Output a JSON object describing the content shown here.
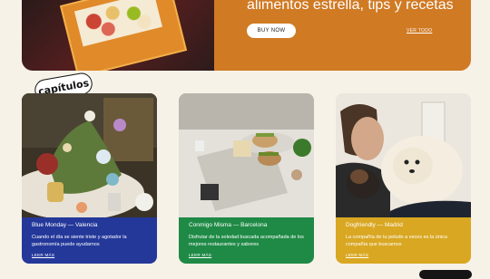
{
  "hero": {
    "title": "alimentos estrella, tips y recetas",
    "buy_label": "BUY NOW",
    "see_all_label": "VER TODO"
  },
  "section_badge": "capítulos",
  "cards": [
    {
      "title": "Blue Monday — Valencia",
      "description": "Cuando el día se siente triste y agotador la gastronomía puede ayudarnos",
      "more": "LEER MÁS",
      "accent": "#24389a"
    },
    {
      "title": "Conmigo Misma — Barcelona",
      "description": "Disfrutar de la soledad buscada acompañada de los mejores restaurantes y sabores",
      "more": "LEER MÁS",
      "accent": "#1f8a46"
    },
    {
      "title": "Dogfriendly — Madrid",
      "description": "La compañía de tu peludo a veces es la única compañía que buscamos",
      "more": "LEER MÁS",
      "accent": "#d9a722"
    }
  ]
}
